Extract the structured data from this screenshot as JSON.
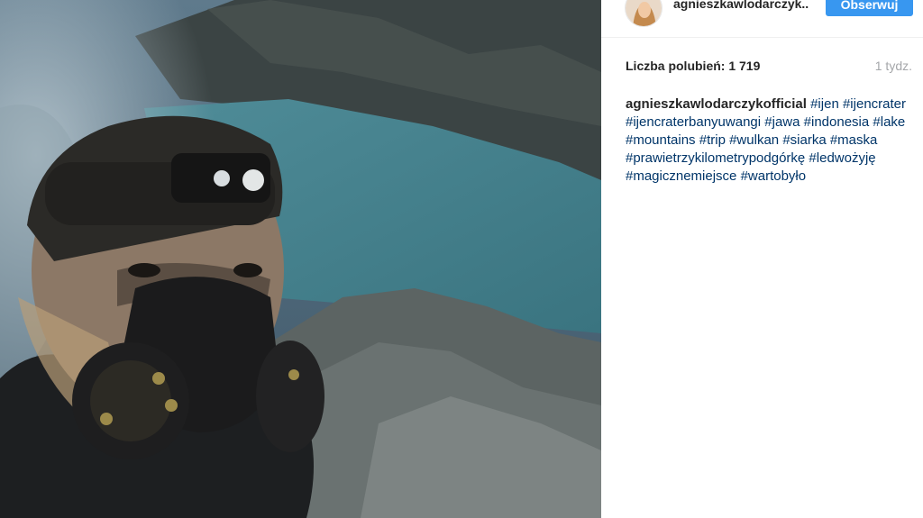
{
  "post": {
    "username": "agnieszkawlodarczyk...",
    "follow_label": "Obserwuj",
    "likes_text": "Liczba polubień: 1 719",
    "time_ago": "1 tydz.",
    "caption_author": "agnieszkawlodarczykofficial",
    "hashtags": [
      "#ijen",
      "#ijencrater",
      "#ijencraterbanyuwangi",
      "#jawa",
      "#indonesia",
      "#lake",
      "#mountains",
      "#trip",
      "#wulkan",
      "#siarka",
      "#maska",
      "#prawietrzykilometrypodgórkę",
      "#ledwożyję",
      "#magicznemiejsce",
      "#wartobyło"
    ]
  },
  "colors": {
    "follow_button": "#3897f0",
    "hashtag": "#003569",
    "time": "#a5a7aa"
  }
}
